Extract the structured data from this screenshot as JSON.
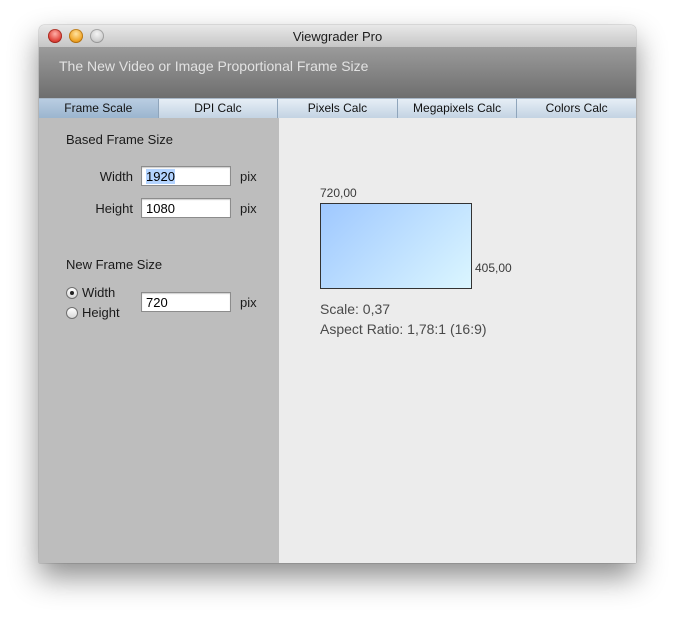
{
  "window": {
    "title": "Viewgrader Pro"
  },
  "banner": {
    "text": "The New Video or Image Proportional Frame Size"
  },
  "tabs": [
    {
      "label": "Frame Scale",
      "active": true
    },
    {
      "label": "DPI Calc",
      "active": false
    },
    {
      "label": "Pixels Calc",
      "active": false
    },
    {
      "label": "Megapixels Calc",
      "active": false
    },
    {
      "label": "Colors Calc",
      "active": false
    }
  ],
  "based": {
    "title": "Based Frame Size",
    "width_label": "Width",
    "width_value": "1920",
    "height_label": "Height",
    "height_value": "1080",
    "unit": "pix"
  },
  "new_frame": {
    "title": "New Frame Size",
    "option_width": "Width",
    "option_height": "Height",
    "selected": "width",
    "value": "720",
    "unit": "pix"
  },
  "preview": {
    "width_label": "720,00",
    "height_label": "405,00",
    "scale": "Scale: 0,37",
    "aspect": "Aspect Ratio: 1,78:1 (16:9)"
  },
  "colors": {
    "accent_tab": "#9bb5cf",
    "preview_start": "#9fc8ff",
    "preview_end": "#dbf6ff"
  }
}
